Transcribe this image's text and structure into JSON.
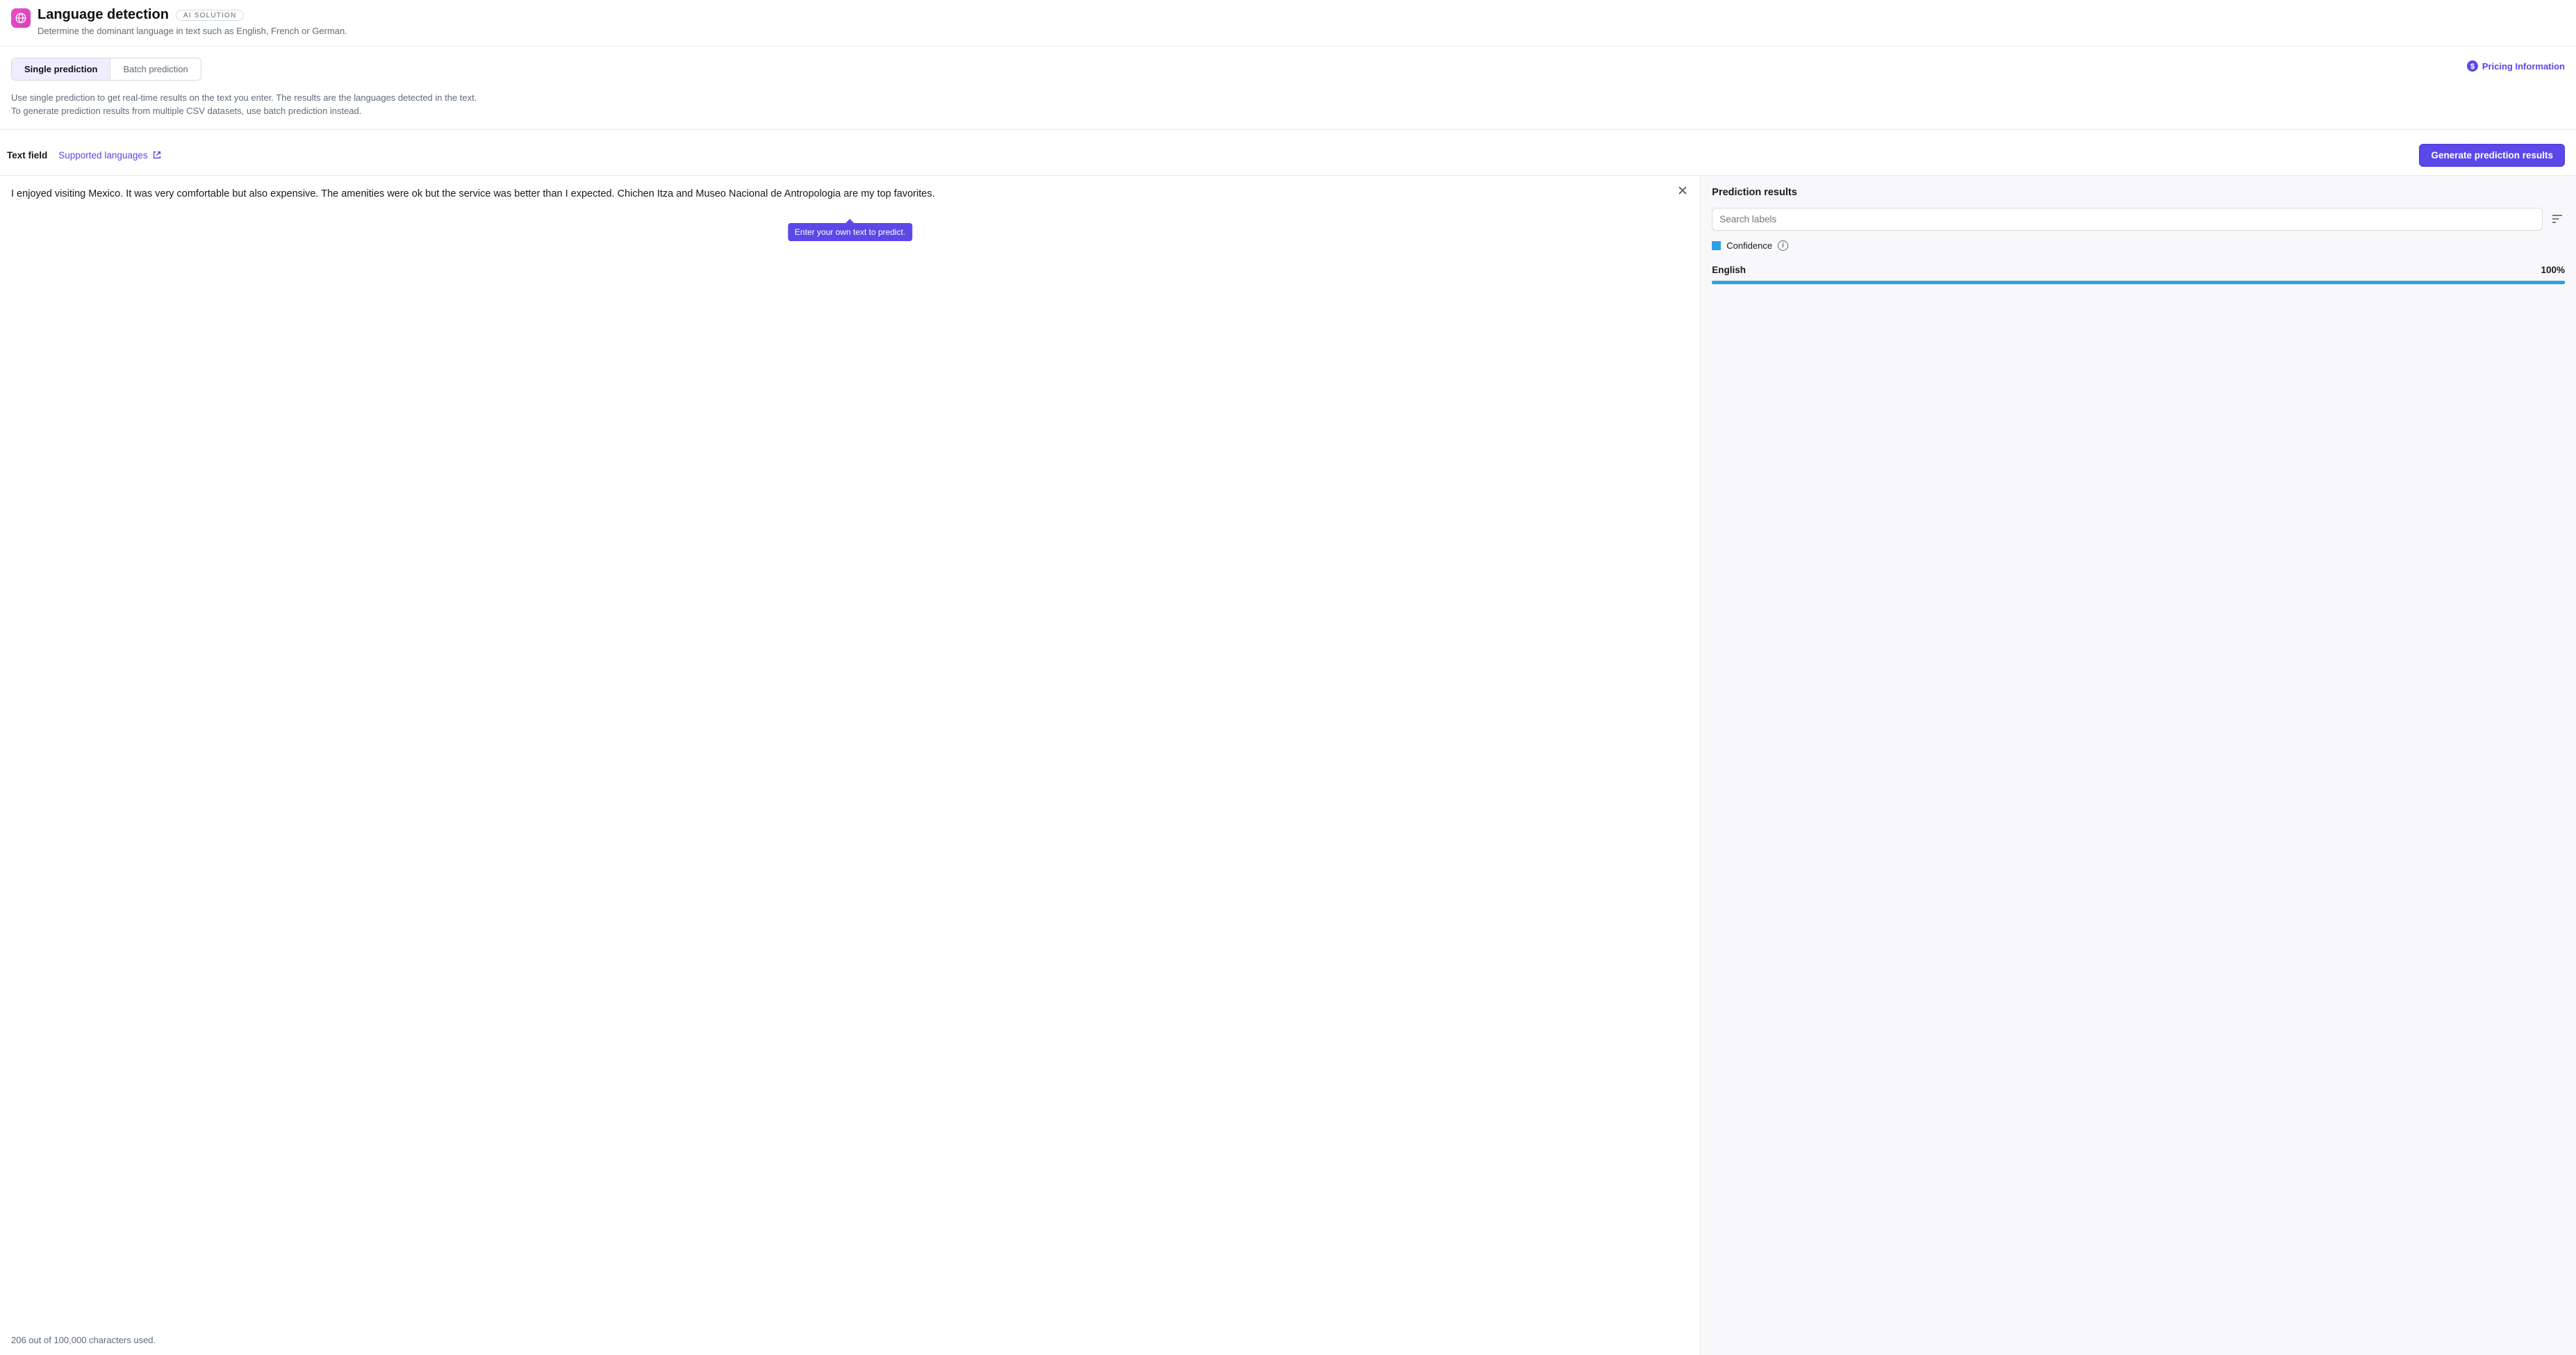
{
  "header": {
    "title": "Language detection",
    "badge": "AI SOLUTION",
    "subtitle": "Determine the dominant language in text such as English, French or German."
  },
  "tabs": {
    "single": "Single prediction",
    "batch": "Batch prediction",
    "description_line1": "Use single prediction to get real-time results on the text you enter. The results are the languages detected in the text.",
    "description_line2": "To generate prediction results from multiple CSV datasets, use batch prediction instead."
  },
  "pricing_link": "Pricing Information",
  "text_field": {
    "label": "Text field",
    "supported_link": "Supported languages",
    "generate_button": "Generate prediction results",
    "value": "I enjoyed visiting Mexico. It was very comfortable but also expensive. The amenities were ok but the service was better than I expected. Chichen Itza and Museo Nacional de Antropologia are my top favorites.",
    "tooltip": "Enter your own text to predict.",
    "char_count": "206 out of 100,000 characters used."
  },
  "results": {
    "title": "Prediction results",
    "search_placeholder": "Search labels",
    "legend_label": "Confidence",
    "items": [
      {
        "label": "English",
        "percent_text": "100%",
        "percent_value": 100
      }
    ]
  },
  "colors": {
    "accent": "#5b48e8",
    "confidence": "#2ea0e6",
    "icon_bg": "#e94ec7"
  }
}
